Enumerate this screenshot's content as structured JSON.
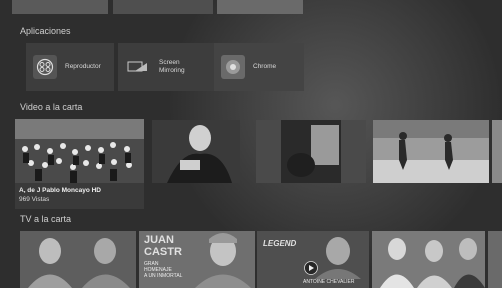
{
  "sections": {
    "apps_title": "Aplicaciones",
    "video_title": "Video a la carta",
    "tv_title": "TV a la carta"
  },
  "apps": [
    {
      "label": "Reproductor",
      "icon": "film-reel-icon"
    },
    {
      "label": "Screen\nMirroring",
      "icon": "screen-mirroring-icon"
    },
    {
      "label": "Chrome",
      "icon": "chrome-icon"
    }
  ],
  "video": {
    "featured_title": "A, de J Pablo Moncayo HD",
    "featured_views": "969 Vistas"
  },
  "tv_tiles": {
    "tile2_lines": [
      "JUAN",
      "CASTR",
      "GRAN",
      "HOMENAJE",
      "A UN INMORTAL"
    ],
    "tile4_title": "LEGEND",
    "tile4_name": "ANTOINE CHEVALIER"
  }
}
